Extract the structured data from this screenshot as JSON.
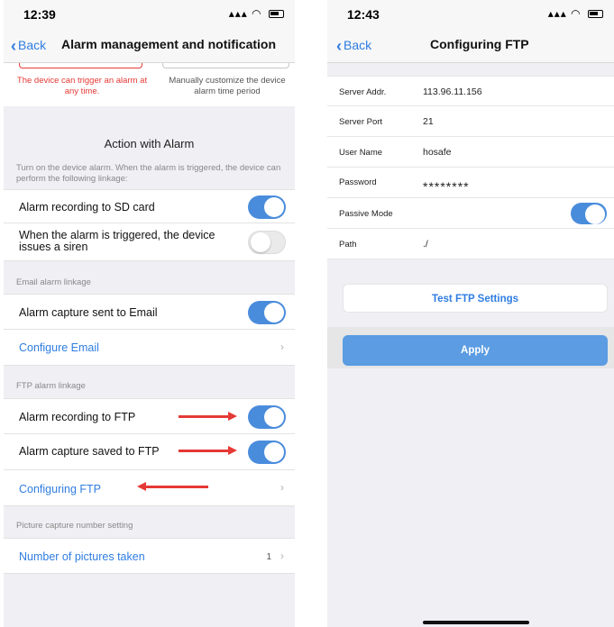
{
  "left": {
    "status_time": "12:39",
    "title": "Alarm management and notification",
    "back": "Back",
    "alarm_type": {
      "left_text": "The device can trigger an alarm at any time.",
      "right_text": "Manually customize the device alarm time period"
    },
    "action_title": "Action with Alarm",
    "action_desc": "Turn on the device alarm. When the alarm is triggered, the device can perform the following linkage:",
    "rows": {
      "sd": "Alarm recording to SD card",
      "siren": "When the alarm is triggered, the device issues a siren"
    },
    "email_section": "Email alarm linkage",
    "email_rows": {
      "capture": "Alarm capture sent to Email",
      "configure": "Configure Email"
    },
    "ftp_section": "FTP alarm linkage",
    "ftp_rows": {
      "recording": "Alarm recording to FTP",
      "capture": "Alarm capture saved to FTP",
      "configure": "Configuring FTP"
    },
    "picture_section": "Picture capture number setting",
    "picture_rows": {
      "label": "Number of pictures taken",
      "value": "1"
    },
    "accent": "#2f7de1",
    "alert_red": "#e53935",
    "toggle_on": "#4a8cdc"
  },
  "right": {
    "status_time": "12:43",
    "back": "Back",
    "title": "Configuring FTP",
    "fields": {
      "server_addr_label": "Server Addr.",
      "server_addr_value": "113.96.11.156",
      "server_port_label": "Server Port",
      "server_port_value": "21",
      "user_name_label": "User Name",
      "user_name_value": "hosafe",
      "password_label": "Password",
      "password_value": "********",
      "passive_label": "Passive Mode",
      "path_label": "Path",
      "path_value": "./"
    },
    "test_button": "Test FTP Settings",
    "apply_button": "Apply"
  }
}
